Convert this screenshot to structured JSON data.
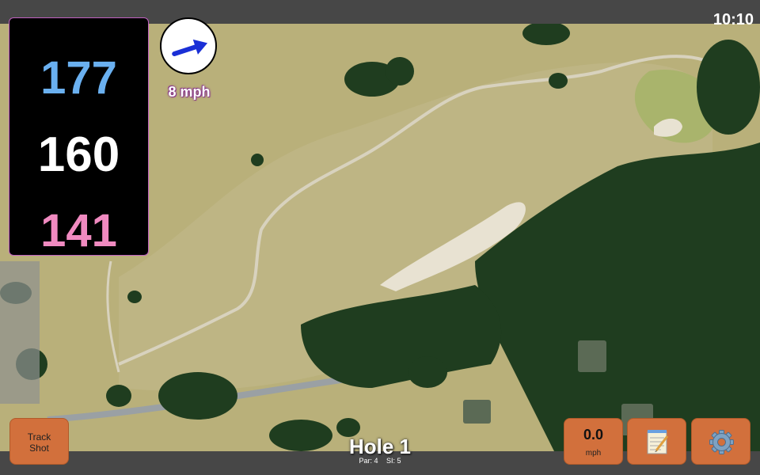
{
  "status": {
    "time": "10:10"
  },
  "distances": {
    "back": "177",
    "middle": "160",
    "front": "141"
  },
  "wind": {
    "speed": "8 mph",
    "icon": "wind-arrow-icon"
  },
  "buttons": {
    "track_shot_line1": "Track",
    "track_shot_line2": "Shot",
    "speed_value": "0.0",
    "speed_unit": "mph",
    "notes_icon": "notepad-icon",
    "settings_icon": "gear-icon"
  },
  "hole": {
    "title": "Hole 1",
    "par": "Par: 4",
    "si": "SI: 5"
  },
  "colors": {
    "button": "#d2703c",
    "back": "#6ab0f0",
    "front": "#f08ac0",
    "fairway": "#b9b07a",
    "trees": "#1f3d1f"
  }
}
